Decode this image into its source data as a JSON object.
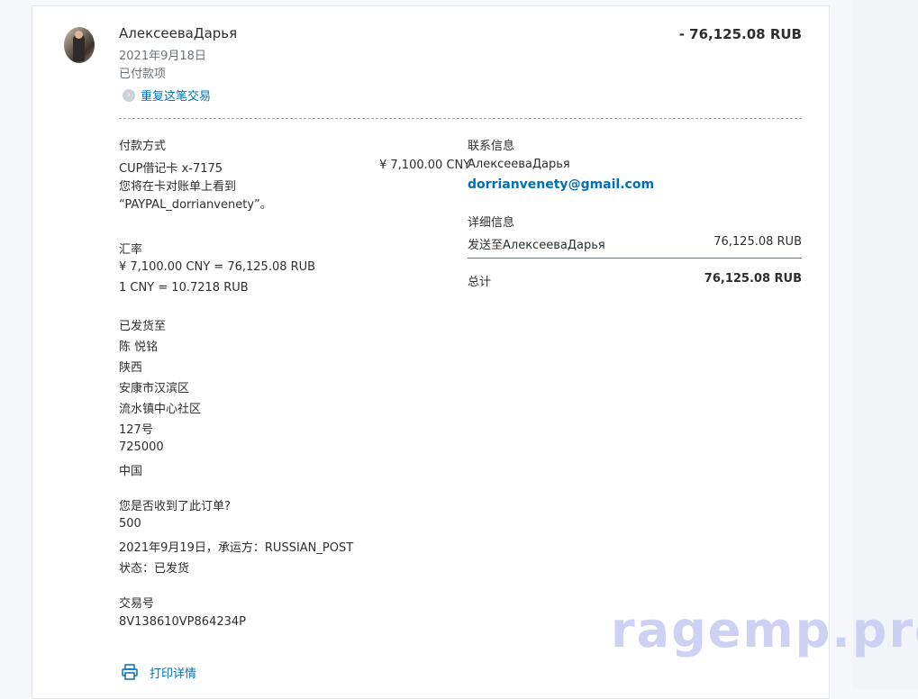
{
  "header": {
    "name": "АлексееваДарья",
    "date": "2021年9月18日",
    "status": "已付款项",
    "repeat_label": "重复这笔交易",
    "amount": "- 76,125.08 RUB"
  },
  "payment": {
    "heading": "付款方式",
    "card": "CUP借记卡 x-7175",
    "card_amount": "¥ 7,100.00 CNY",
    "statement_line1": "您将在卡对账单上看到",
    "statement_line2": "“PAYPAL_dorrianvenety”。"
  },
  "exchange": {
    "heading": "汇率",
    "line1": "¥ 7,100.00 CNY = 76,125.08 RUB",
    "line2": "1 CNY = 10.7218 RUB"
  },
  "shipping": {
    "heading": "已发货至",
    "lines": [
      "陈 悦铭",
      "陕西",
      "安康市汉滨区",
      "流水镇中心社区",
      "127号",
      "725000",
      "中国"
    ]
  },
  "order": {
    "question": "您是否收到了此订单?",
    "line1": "500",
    "line2": "2021年9月19日，承运方：RUSSIAN_POST",
    "line3": "状态：已发货"
  },
  "transaction": {
    "heading": "交易号",
    "id": "8V138610VP864234P"
  },
  "contact": {
    "heading": "联系信息",
    "name": "АлексееваДарья",
    "email": "dorrianvenety@gmail.com"
  },
  "details": {
    "heading": "详细信息",
    "sent_label": "发送至АлексееваДарья",
    "sent_value": "76,125.08 RUB",
    "total_label": "总计",
    "total_value": "76,125.08 RUB"
  },
  "print_label": "打印详情",
  "watermark": "ragemp.pro",
  "icons": {
    "repeat": "chevron-right-circle-icon",
    "print": "printer-icon"
  },
  "colors": {
    "link": "#0070ba",
    "text": "#2c2e2f",
    "muted": "#6c7378"
  }
}
